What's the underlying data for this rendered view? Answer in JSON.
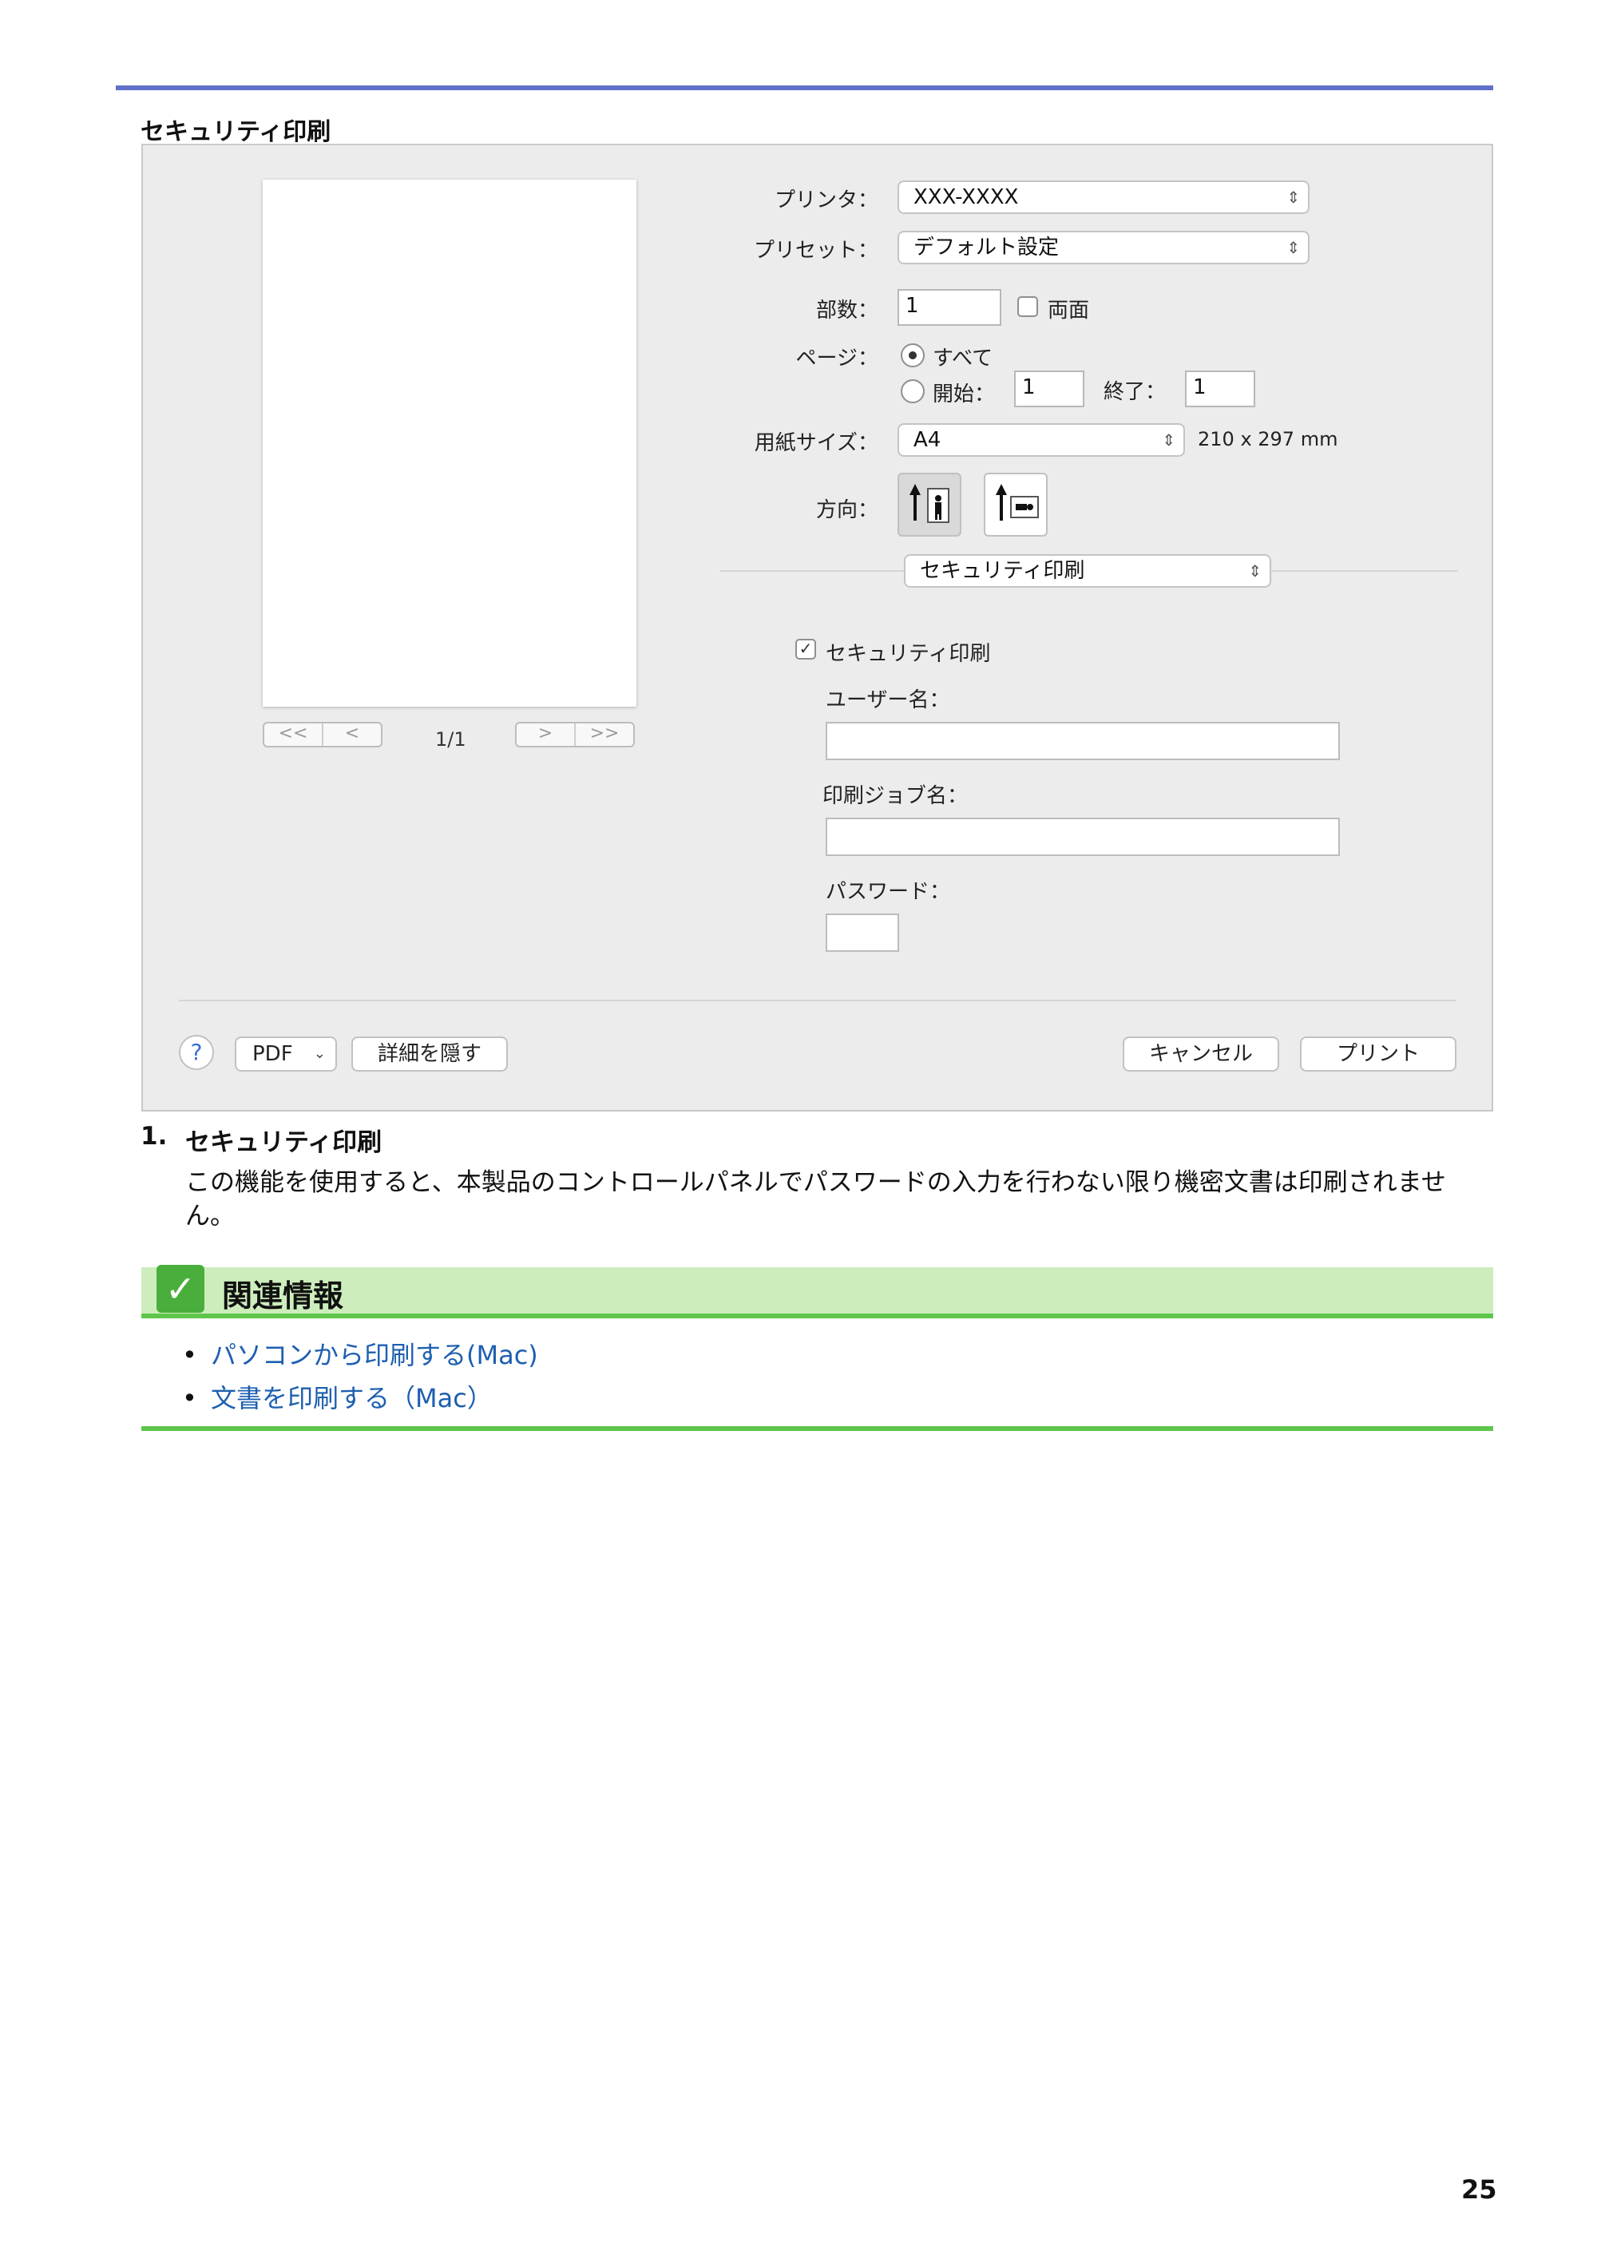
{
  "section_title": "セキュリティ印刷",
  "dialog": {
    "preview": {
      "nav_first": "<<",
      "nav_prev": "<",
      "nav_next": ">",
      "nav_last": ">>",
      "page_count": "1/1"
    },
    "printer": {
      "label": "プリンタ：",
      "value": "XXX-XXXX"
    },
    "preset": {
      "label": "プリセット：",
      "value": "デフォルト設定"
    },
    "copies": {
      "label": "部数：",
      "value": "1",
      "duplex_label": "両面",
      "duplex_checked": false
    },
    "pages": {
      "label": "ページ：",
      "all_label": "すべて",
      "from_label": "開始：",
      "from_value": "1",
      "to_label": "終了：",
      "to_value": "1",
      "selected": "all"
    },
    "paper_size": {
      "label": "用紙サイズ：",
      "value": "A4",
      "dimensions": "210 x 297 mm"
    },
    "orientation": {
      "label": "方向：",
      "selected": "portrait"
    },
    "panel_popup": {
      "value": "セキュリティ印刷"
    },
    "secure_print": {
      "checkbox_label": "セキュリティ印刷",
      "checked": true,
      "user_name_label": "ユーザー名：",
      "user_name_value": "",
      "job_name_label": "印刷ジョブ名：",
      "job_name_value": "",
      "password_label": "パスワード：",
      "password_value": ""
    },
    "footer": {
      "help": "?",
      "pdf": "PDF",
      "hide_details": "詳細を隠す",
      "cancel": "キャンセル",
      "print": "プリント"
    }
  },
  "item": {
    "number": "1.",
    "title": "セキュリティ印刷",
    "description": "この機能を使用すると、本製品のコントロールパネルでパスワードの入力を行わない限り機密文書は印刷されません。"
  },
  "related": {
    "title": "関連情報",
    "links": [
      "パソコンから印刷する(Mac)",
      "文書を印刷する（Mac）"
    ]
  },
  "page_number": "25",
  "colors": {
    "top_rule": "#6170c8",
    "related_bar": "#cdeebc",
    "related_rule": "#5ec64a",
    "link": "#1d5fb0"
  }
}
